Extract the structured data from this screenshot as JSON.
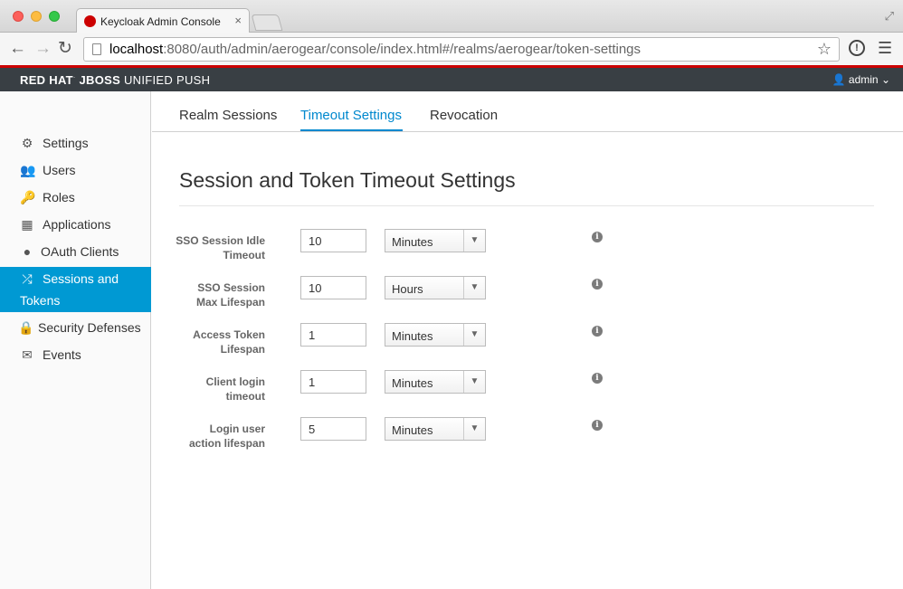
{
  "browser": {
    "tab_title": "Keycloak Admin Console",
    "tab_close": "×",
    "url_host": "localhost",
    "url_rest": ":8080/auth/admin/aerogear/console/index.html#/realms/aerogear/token-settings",
    "icons": [
      "back-arrow-icon",
      "forward-arrow-icon",
      "reload-icon",
      "page-icon",
      "star-icon",
      "extension-icon",
      "menu-icon",
      "resize-icon"
    ]
  },
  "appbar": {
    "brand_bold": "RED HAT",
    "brand_sup": "·",
    "brand_mid": " JBOSS",
    "brand_rest": " UNIFIED PUSH",
    "user": "admin",
    "accent_color": "#cc0000",
    "bar_color": "#393f44"
  },
  "sidebar": {
    "active_color": "#0099d3",
    "items": [
      {
        "label": "Settings",
        "icon": "gears-icon"
      },
      {
        "label": "Users",
        "icon": "users-icon"
      },
      {
        "label": "Roles",
        "icon": "key-icon"
      },
      {
        "label": "Applications",
        "icon": "grid-icon"
      },
      {
        "label": "OAuth Clients",
        "icon": "globe-icon"
      },
      {
        "label": "Sessions and",
        "label2": "Tokens",
        "icon": "shuffle-icon"
      },
      {
        "label": "Security Defenses",
        "icon": "lock-icon"
      },
      {
        "label": "Events",
        "icon": "envelope-icon"
      }
    ]
  },
  "tabs": [
    {
      "label": "Realm Sessions"
    },
    {
      "label": "Timeout Settings"
    },
    {
      "label": "Revocation"
    }
  ],
  "form": {
    "title": "Session and Token Timeout Settings",
    "rows": [
      {
        "label1": "SSO Session Idle",
        "label2": "Timeout",
        "value": "10",
        "unit": "Minutes"
      },
      {
        "label1": "SSO Session",
        "label2": "Max Lifespan",
        "value": "10",
        "unit": "Hours"
      },
      {
        "label1": "Access Token",
        "label2": "Lifespan",
        "value": "1",
        "unit": "Minutes"
      },
      {
        "label1": "Client login",
        "label2": "timeout",
        "value": "1",
        "unit": "Minutes"
      },
      {
        "label1": "Login user",
        "label2": "action lifespan",
        "value": "5",
        "unit": "Minutes"
      }
    ],
    "info_glyph": "i"
  }
}
